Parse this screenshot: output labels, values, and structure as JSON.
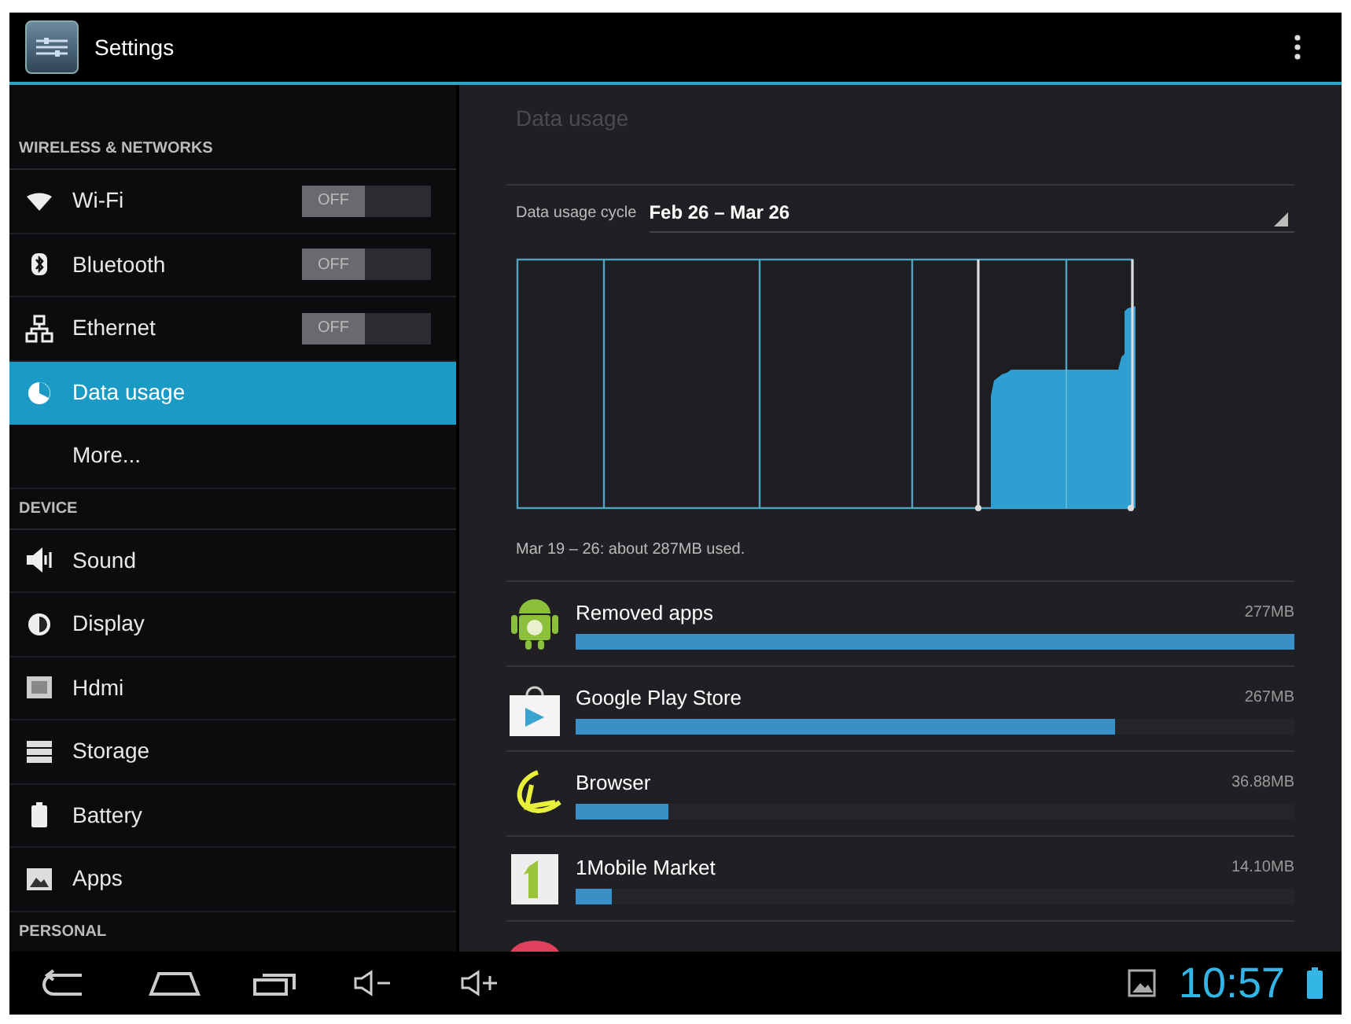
{
  "action_bar": {
    "title": "Settings"
  },
  "sidebar": {
    "sections": [
      {
        "header": "WIRELESS & NETWORKS",
        "items": [
          {
            "label": "Wi-Fi",
            "selected": false,
            "toggle": {
              "label": "OFF",
              "on": false
            }
          },
          {
            "label": "Bluetooth",
            "selected": false,
            "toggle": {
              "label": "OFF",
              "on": false
            }
          },
          {
            "label": "Ethernet",
            "selected": false,
            "toggle": {
              "label": "OFF",
              "on": false
            }
          },
          {
            "label": "Data usage",
            "selected": true
          },
          {
            "label": "More...",
            "selected": false
          }
        ]
      },
      {
        "header": "DEVICE",
        "items": [
          {
            "label": "Sound",
            "selected": false
          },
          {
            "label": "Display",
            "selected": false
          },
          {
            "label": "Hdmi",
            "selected": false
          },
          {
            "label": "Storage",
            "selected": false
          },
          {
            "label": "Battery",
            "selected": false
          },
          {
            "label": "Apps",
            "selected": false
          }
        ]
      },
      {
        "header": "PERSONAL"
      }
    ]
  },
  "detail": {
    "title": "Data usage",
    "cycle_label": "Data usage cycle",
    "cycle_value": "Feb 26 – Mar 26",
    "summary": "Mar 19 – 26: about 287MB used.",
    "apps": [
      {
        "name": "Removed apps",
        "usage": "277MB",
        "level": 1.0
      },
      {
        "name": "Google Play Store",
        "usage": "267MB",
        "level": 0.75
      },
      {
        "name": "Browser",
        "usage": "36.88MB",
        "level": 0.13
      },
      {
        "name": "1Mobile Market",
        "usage": "14.10MB",
        "level": 0.05
      }
    ]
  },
  "nav_bar": {
    "time": "10:57"
  }
}
